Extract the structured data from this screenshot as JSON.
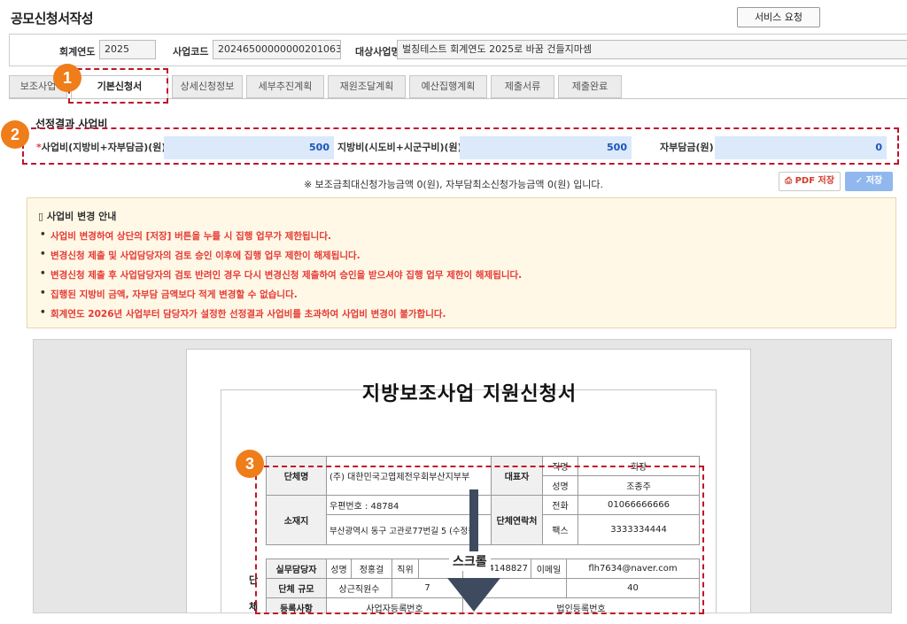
{
  "page": {
    "title": "공모신청서작성",
    "service_button": "서비스 요청"
  },
  "info": {
    "fiscal_year_label": "회계연도",
    "fiscal_year": "2025",
    "project_code_label": "사업코드",
    "project_code": "20246500000000201063",
    "target_label": "대상사업명",
    "target_value": "벌칭테스트 회계연도 2025로 바꿈 건들지마셈"
  },
  "tabs": [
    "보조사업",
    "기본신청서",
    "상세신청정보",
    "세부추진계획",
    "재원조달계획",
    "예산집행계획",
    "제출서류",
    "제출완료"
  ],
  "badges": [
    "1",
    "2",
    "3"
  ],
  "cost": {
    "section_title": "선정결과 사업비",
    "required_mark": "*",
    "total_label": "사업비(지방비+자부담금)(원)",
    "total_value": "500",
    "local_label": "지방비(시도비+시군구비)(원)",
    "local_value": "500",
    "self_label": "자부담금(원)",
    "self_value": "0"
  },
  "notice": "※ 보조금최대신청가능금액 0(원), 자부담최소신청가능금액 0(원) 입니다.",
  "buttons": {
    "pdf": "PDF 저장",
    "save": "저장"
  },
  "guide": {
    "title": "사업비 변경 안내",
    "items": [
      "사업비 변경하여 상단의 [저장] 버튼을 누를 시 집행 업무가 제한됩니다.",
      "변경신청 제출 및 사업담당자의 검토 승인 이후에 집행 업무 제한이 해제됩니다.",
      "변경신청 제출 후 사업담당자의 검토 반려인 경우 다시 변경신청 제출하여 승인을 받으셔야 집행 업무 제한이 해제됩니다.",
      "집행된 지방비 금액, 자부담 금액보다 적게 변경할 수 없습니다.",
      "회계연도 2026년 사업부터 담당자가 설정한 선정결과 사업비를 초과하여 사업비 변경이 불가합니다."
    ]
  },
  "document": {
    "title": "지방보조사업 지원신청서",
    "side_1": "단",
    "side_2": "체",
    "org_name_label": "단체명",
    "org_name": "(주) 대한민국고엽제전우회부산지부부",
    "rep_label": "대표자",
    "rep_title_label": "직명",
    "rep_title": "회장",
    "rep_name_label": "성명",
    "rep_name": "조종주",
    "addr_label": "소재지",
    "addr_zip": "우편번호 : 48784",
    "addr_line": "부산광역시 동구 고관로77번길 5 (수정동)",
    "contact_label": "단체연락처",
    "phone_label": "전화",
    "phone": "01066666666",
    "fax_label": "팩스",
    "fax": "3333334444",
    "staff_label": "실무담당자",
    "staff_name_label": "성명",
    "staff_name": "정홍걸",
    "staff_pos_label": "직위",
    "staff_phone": "01024148827",
    "email_label": "이메일",
    "email": "flh7634@naver.com",
    "scale_label": "단체 규모",
    "scale_sub_label": "상근직원수",
    "scale_staff": "7",
    "scale_members": "40",
    "bottom_row": "등록사항",
    "bottom_row_2": "사업자등록번호",
    "bottom_row_3": "법인등록번호"
  },
  "scroll_hint": "스크롤"
}
